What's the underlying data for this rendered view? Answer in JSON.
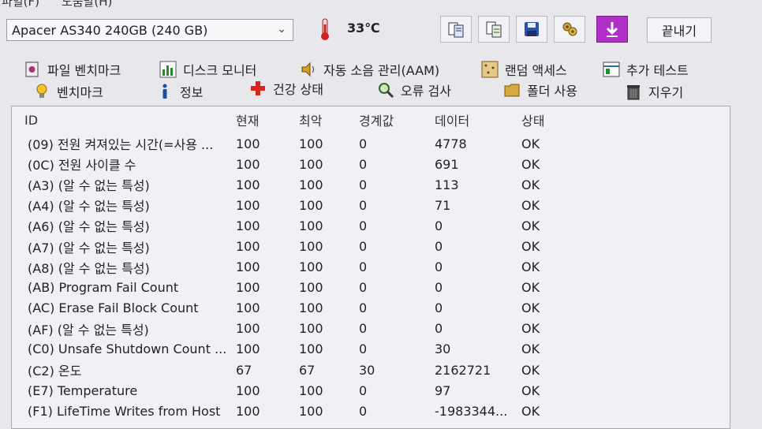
{
  "menu": [
    "파일(F)",
    "도움말(H)"
  ],
  "drive": {
    "selected": "Apacer AS340 240GB (240 GB)"
  },
  "temperature": "33℃",
  "exit_label": "끝내기",
  "tabs_row1": [
    "파일 벤치마크",
    "디스크 모니터",
    "자동 소음 관리(AAM)",
    "랜덤 액세스",
    "추가 테스트"
  ],
  "tabs_row2": [
    "벤치마크",
    "정보",
    "건강 상태",
    "오류 검사",
    "폴더 사용",
    "지우기"
  ],
  "columns": [
    "ID",
    "현재",
    "최악",
    "경계값",
    "데이터",
    "상태"
  ],
  "rows": [
    {
      "id": "(09) 전원 켜져있는 시간(=사용 ...",
      "current": "100",
      "worst": "100",
      "threshold": "0",
      "data": "4778",
      "status": "OK"
    },
    {
      "id": "(0C) 전원 사이클 수",
      "current": "100",
      "worst": "100",
      "threshold": "0",
      "data": "691",
      "status": "OK"
    },
    {
      "id": "(A3) (알 수 없는 특성)",
      "current": "100",
      "worst": "100",
      "threshold": "0",
      "data": "113",
      "status": "OK"
    },
    {
      "id": "(A4) (알 수 없는 특성)",
      "current": "100",
      "worst": "100",
      "threshold": "0",
      "data": "71",
      "status": "OK"
    },
    {
      "id": "(A6) (알 수 없는 특성)",
      "current": "100",
      "worst": "100",
      "threshold": "0",
      "data": "0",
      "status": "OK"
    },
    {
      "id": "(A7) (알 수 없는 특성)",
      "current": "100",
      "worst": "100",
      "threshold": "0",
      "data": "0",
      "status": "OK"
    },
    {
      "id": "(A8) (알 수 없는 특성)",
      "current": "100",
      "worst": "100",
      "threshold": "0",
      "data": "0",
      "status": "OK"
    },
    {
      "id": "(AB) Program Fail Count",
      "current": "100",
      "worst": "100",
      "threshold": "0",
      "data": "0",
      "status": "OK"
    },
    {
      "id": "(AC) Erase Fail Block Count",
      "current": "100",
      "worst": "100",
      "threshold": "0",
      "data": "0",
      "status": "OK"
    },
    {
      "id": "(AF) (알 수 없는 특성)",
      "current": "100",
      "worst": "100",
      "threshold": "0",
      "data": "0",
      "status": "OK"
    },
    {
      "id": "(C0) Unsafe Shutdown Count ...",
      "current": "100",
      "worst": "100",
      "threshold": "0",
      "data": "30",
      "status": "OK"
    },
    {
      "id": "(C2) 온도",
      "current": "67",
      "worst": "67",
      "threshold": "30",
      "data": "2162721",
      "status": "OK"
    },
    {
      "id": "(E7) Temperature",
      "current": "100",
      "worst": "100",
      "threshold": "0",
      "data": "97",
      "status": "OK"
    },
    {
      "id": "(F1) LifeTime Writes from Host",
      "current": "100",
      "worst": "100",
      "threshold": "0",
      "data": "-1983344...",
      "status": "OK"
    }
  ],
  "colors": {
    "panel_bg": "#f1f1f5",
    "window_bg": "#e8e8ec",
    "text": "#1d1d26",
    "health_icon": "#d9261c",
    "erase_icon": "#a020b0"
  },
  "icons": {
    "toolbar": [
      "copy-icon",
      "copy-text-icon",
      "save-icon",
      "options-icon",
      "download-icon"
    ],
    "tabs_row1": [
      "file-benchmark-icon",
      "disk-monitor-icon",
      "speaker-icon",
      "random-access-icon",
      "extra-tests-icon"
    ],
    "tabs_row2": [
      "lightbulb-icon",
      "info-icon",
      "health-cross-icon",
      "magnifier-icon",
      "folder-icon",
      "trash-icon"
    ]
  }
}
